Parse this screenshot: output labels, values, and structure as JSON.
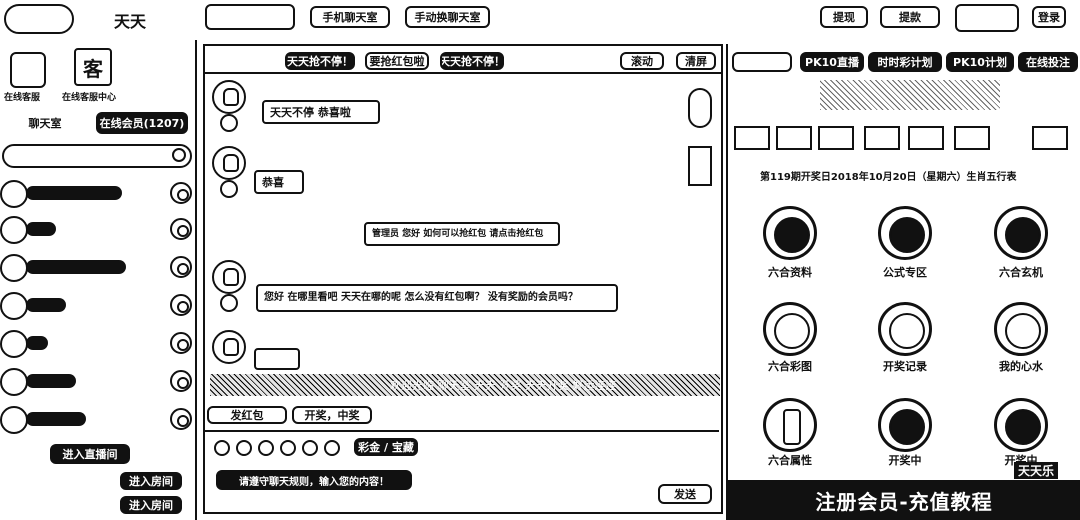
{
  "header": {
    "logo_text": "天天",
    "search_value": "",
    "mobile_chat_label": "手机聊天室",
    "manual_plan_label": "手动换聊天室",
    "withdraw_label": "提现",
    "withdraw_label2": "提款",
    "login_label": "登录"
  },
  "sidebar": {
    "top_icons": [
      {
        "label": "在线客服"
      },
      {
        "label": "在线客服中心",
        "glyph": "客"
      }
    ],
    "tabs": [
      "聊天室",
      "在线会员(1207)"
    ],
    "search_placeholder": "",
    "members": [
      "",
      "",
      "",
      "",
      "",
      "",
      ""
    ],
    "bottom_actions": [
      "进入直播间",
      "进入房间",
      "进入房间"
    ]
  },
  "chat": {
    "ticker": [
      "天天抢不停！",
      "要抢红包啦",
      "天天抢不停！"
    ],
    "top_buttons": [
      "滚动",
      "清屏"
    ],
    "messages": [
      {
        "text": "天天不停 恭喜啦"
      },
      {
        "text": "恭喜"
      },
      {
        "text": "管理员 您好 如何可以抢红包 请点击抢红包"
      },
      {
        "text": "您好 在哪里看吧 天天在哪的呢 怎么没有红包啊？ 没有奖励的会员吗？"
      },
      {
        "text": ""
      }
    ],
    "marquee": "欢迎光临 聊天室 天天 开奖 天天开奖 好运连连",
    "quick_buttons": [
      "发红包",
      "开奖，中奖"
    ],
    "toolbar_label": "彩金 / 宝藏",
    "input_placeholder": "请遵守聊天规则，输入您的内容！",
    "send_label": "发送"
  },
  "right": {
    "tabs": [
      "PK10直播",
      "时时彩计划",
      "PK10计划",
      "在线投注"
    ],
    "issue_text": "第119期开奖日2018年10月20日（星期六）生肖五行表",
    "grid": [
      {
        "label": "六合资料",
        "icon": "document-icon"
      },
      {
        "label": "公式专区",
        "icon": "formula-icon"
      },
      {
        "label": "六合玄机",
        "icon": "wheel-icon"
      },
      {
        "label": "六合彩图",
        "icon": "image-icon"
      },
      {
        "label": "开奖记录",
        "icon": "record-icon"
      },
      {
        "label": "我的心水",
        "icon": "heart-icon"
      },
      {
        "label": "六合属性",
        "icon": "attribute-icon"
      },
      {
        "label": "开奖中",
        "icon": "live-icon"
      },
      {
        "label": "开奖中",
        "icon": "live2-icon"
      }
    ],
    "banner": "注册会员-充值教程",
    "watermark": "天天乐"
  }
}
